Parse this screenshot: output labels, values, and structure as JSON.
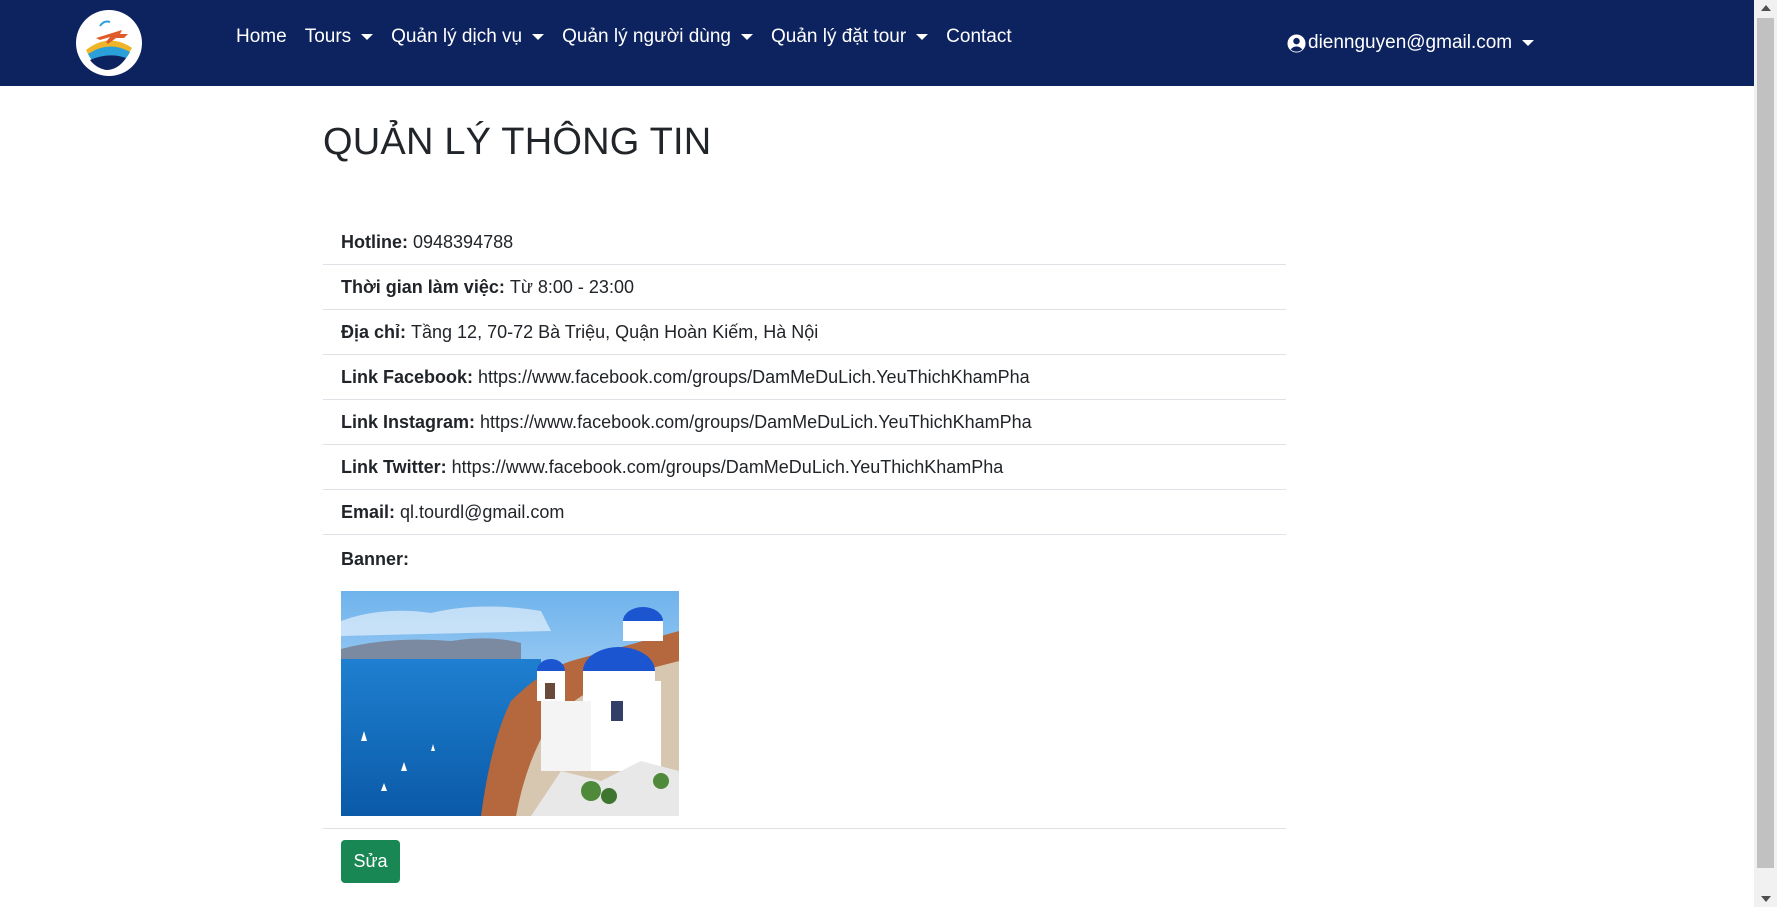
{
  "navbar": {
    "logo_icon": "travel-plane-logo",
    "links": [
      {
        "label": "Home",
        "dropdown": false
      },
      {
        "label": "Tours",
        "dropdown": true
      },
      {
        "label": "Quản lý dịch vụ",
        "dropdown": true
      },
      {
        "label": "Quản lý người dùng",
        "dropdown": true
      },
      {
        "label": "Quản lý đặt tour",
        "dropdown": true
      },
      {
        "label": "Contact",
        "dropdown": false
      }
    ],
    "user_email": "diennguyen@gmail.com",
    "user_icon": "user-circle-icon",
    "background_color": "#0d2360"
  },
  "page": {
    "title": "QUẢN LÝ THÔNG TIN"
  },
  "info": {
    "hotline": {
      "label": "Hotline:",
      "value": "0948394788"
    },
    "working_hours": {
      "label": "Thời gian làm việc:",
      "value": "Từ 8:00 - 23:00"
    },
    "address": {
      "label": "Địa chỉ:",
      "value": "Tầng 12, 70-72 Bà Triệu, Quận Hoàn Kiếm, Hà Nội"
    },
    "facebook": {
      "label": "Link Facebook:",
      "value": "https://www.facebook.com/groups/DamMeDuLich.YeuThichKhamPha"
    },
    "instagram": {
      "label": "Link Instagram:",
      "value": "https://www.facebook.com/groups/DamMeDuLich.YeuThichKhamPha"
    },
    "twitter": {
      "label": "Link Twitter:",
      "value": "https://www.facebook.com/groups/DamMeDuLich.YeuThichKhamPha"
    },
    "email": {
      "label": "Email:",
      "value": "ql.tourdl@gmail.com"
    },
    "banner": {
      "label": "Banner:"
    }
  },
  "actions": {
    "edit_label": "Sửa",
    "edit_color": "#198754"
  }
}
